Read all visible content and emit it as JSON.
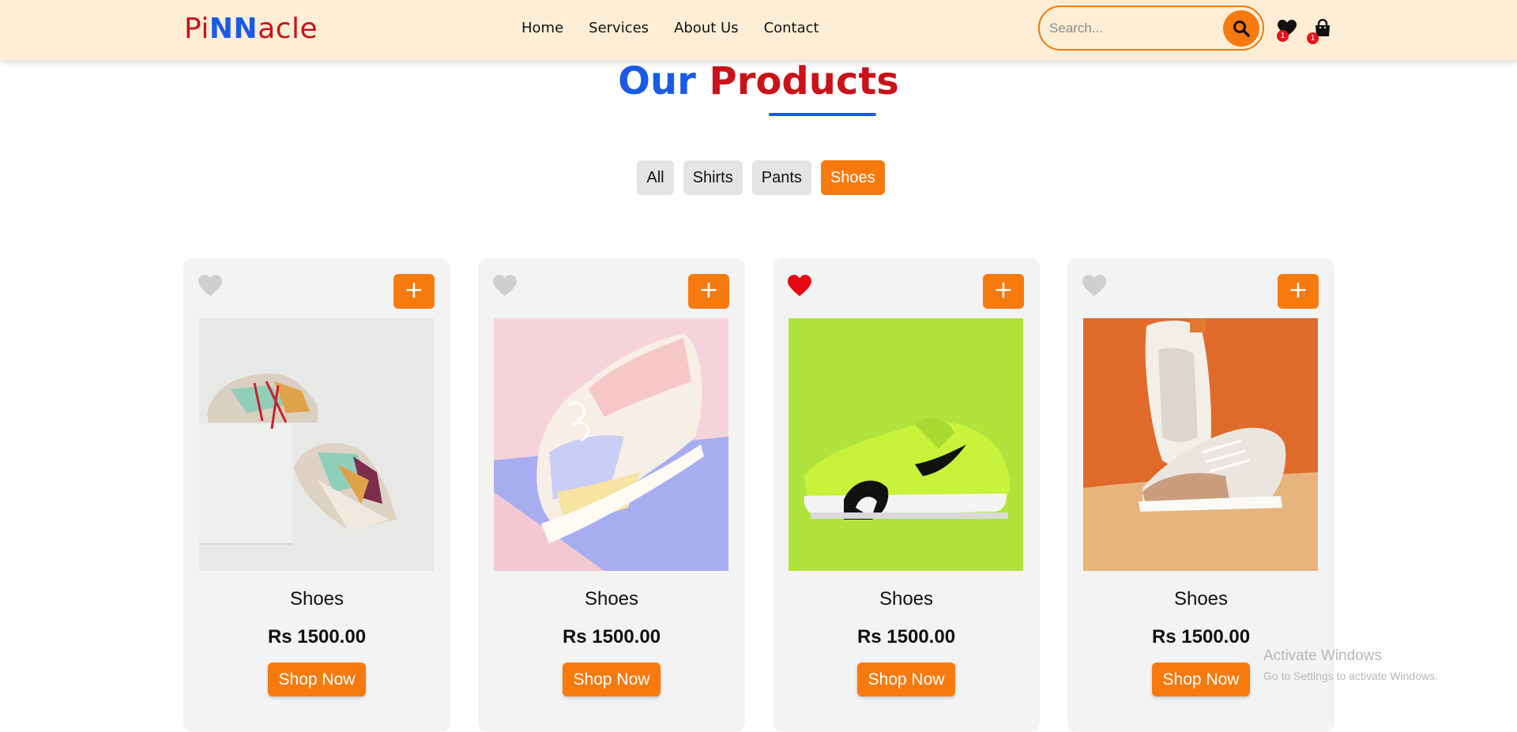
{
  "header": {
    "logo_parts": [
      "Pi",
      "NN",
      "acle"
    ],
    "nav": [
      "Home",
      "Services",
      "About Us",
      "Contact"
    ],
    "search_placeholder": "Search...",
    "wishlist_count": "1",
    "cart_count": "1"
  },
  "title": {
    "part1": "Our",
    "part2": "Products"
  },
  "filters": [
    "All",
    "Shirts",
    "Pants",
    "Shoes"
  ],
  "active_filter": "Shoes",
  "products": [
    {
      "name": "Shoes",
      "price": "Rs 1500.00",
      "button": "Shop Now",
      "add": "+",
      "favorited": false
    },
    {
      "name": "Shoes",
      "price": "Rs 1500.00",
      "button": "Shop Now",
      "add": "+",
      "favorited": false
    },
    {
      "name": "Shoes",
      "price": "Rs 1500.00",
      "button": "Shop Now",
      "add": "+",
      "favorited": true
    },
    {
      "name": "Shoes",
      "price": "Rs 1500.00",
      "button": "Shop Now",
      "add": "+",
      "favorited": false
    }
  ],
  "watermark": {
    "line1": "Activate Windows",
    "line2": "Go to Settings to activate Windows."
  },
  "colors": {
    "accent": "#f77a0f",
    "blue": "#1a5be6",
    "red": "#c8131a",
    "header_bg": "#feeed5",
    "card_bg": "#f3f3f3"
  }
}
